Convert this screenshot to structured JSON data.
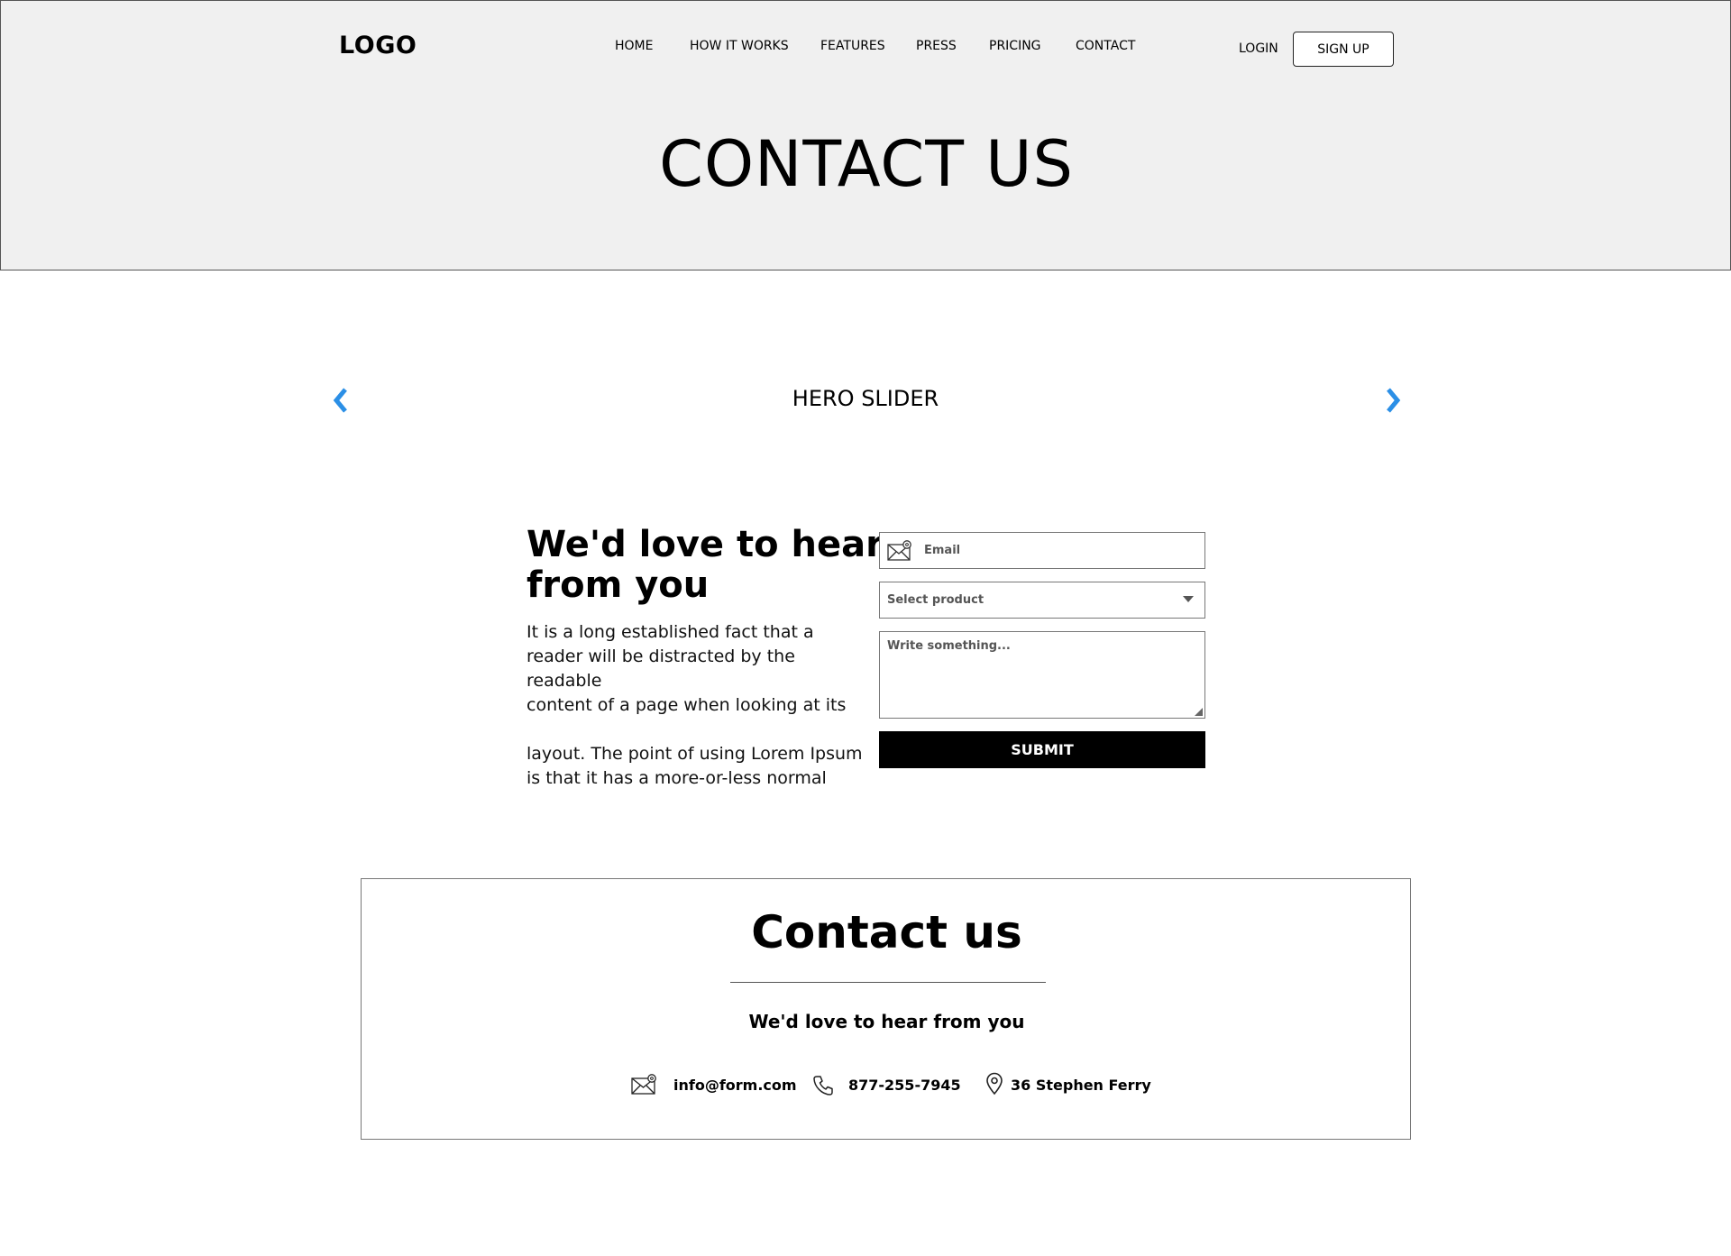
{
  "header": {
    "logo": "LOGO",
    "nav": [
      "HOME",
      "HOW IT WORKS",
      "FEATURES",
      "PRESS",
      "PRICING",
      "CONTACT"
    ],
    "login_label": "LOGIN",
    "signup_label": "SIGN UP",
    "hero_title": "CONTACT US"
  },
  "slider": {
    "label": "HERO SLIDER",
    "prev_icon": "chevron-left-icon",
    "next_icon": "chevron-right-icon",
    "arrow_color": "#2b8fe6"
  },
  "intro": {
    "title": "We'd love to hear from you",
    "paragraphs": [
      "It is a long established fact that a reader will be distracted by the readable",
      "content of a page when looking at its",
      "layout. The point of using Lorem Ipsum is that it has a more-or-less normal"
    ]
  },
  "form": {
    "email_placeholder": "Email",
    "email_icon": "mail-icon",
    "select_placeholder": "Select product",
    "select_icon": "caret-down-icon",
    "message_placeholder": "Write something...",
    "submit_label": "SUBMIT"
  },
  "contact_card": {
    "title": "Contact us",
    "subtitle": "We'd love to hear from you",
    "email": "info@form.com",
    "phone": "877-255-7945",
    "address": "36 Stephen Ferry",
    "icons": [
      "mail-icon",
      "phone-icon",
      "location-pin-icon"
    ]
  }
}
